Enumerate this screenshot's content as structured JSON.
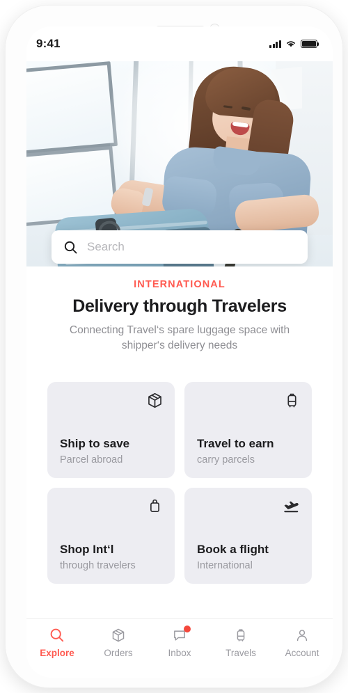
{
  "status_bar": {
    "time": "9:41",
    "signal_icon": "cellular-signal-icon",
    "wifi_icon": "wifi-icon",
    "battery_icon": "battery-icon"
  },
  "hero": {
    "alt": "woman in denim shirt sitting with blue suitcase by bright windows"
  },
  "search": {
    "placeholder": "Search",
    "icon": "search-icon"
  },
  "hero_text": {
    "eyebrow": "INTERNATIONAL",
    "headline": "Delivery through Travelers",
    "subhead": "Connecting Travel‘s spare luggage space with shipper‘s delivery needs"
  },
  "cards": [
    {
      "title": "Ship to save",
      "subtitle": "Parcel abroad",
      "icon": "package-box-icon"
    },
    {
      "title": "Travel to earn",
      "subtitle": "carry parcels",
      "icon": "suitcase-icon"
    },
    {
      "title": "Shop Int‘l",
      "subtitle": "through travelers",
      "icon": "shopping-bag-icon"
    },
    {
      "title": "Book a flight",
      "subtitle": "International",
      "icon": "airplane-takeoff-icon"
    }
  ],
  "tabs": [
    {
      "label": "Explore",
      "icon": "search-icon",
      "active": true,
      "badge": false
    },
    {
      "label": "Orders",
      "icon": "package-box-icon",
      "active": false,
      "badge": false
    },
    {
      "label": "Inbox",
      "icon": "chat-bubble-icon",
      "active": false,
      "badge": true
    },
    {
      "label": "Travels",
      "icon": "suitcase-icon",
      "active": false,
      "badge": false
    },
    {
      "label": "Account",
      "icon": "person-icon",
      "active": false,
      "badge": false
    }
  ],
  "colors": {
    "accent": "#FF5A50",
    "badge": "#F4483C",
    "card_bg": "#EDEDF2",
    "text_primary": "#1C1C1E",
    "text_secondary": "#9A9AA0"
  }
}
